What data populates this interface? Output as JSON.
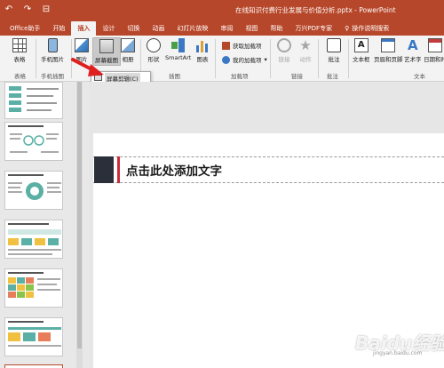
{
  "window": {
    "title": "在线知识付费行业发展与价值分析.pptx - PowerPoint",
    "quick_access": [
      "↶",
      "↷",
      "⊟"
    ]
  },
  "tabs": [
    {
      "label": "Office助手",
      "active": false
    },
    {
      "label": "开始",
      "active": false
    },
    {
      "label": "插入",
      "active": true
    },
    {
      "label": "设计",
      "active": false
    },
    {
      "label": "切换",
      "active": false
    },
    {
      "label": "动画",
      "active": false
    },
    {
      "label": "幻灯片放映",
      "active": false
    },
    {
      "label": "审阅",
      "active": false
    },
    {
      "label": "视图",
      "active": false
    },
    {
      "label": "帮助",
      "active": false
    },
    {
      "label": "万兴PDF专家",
      "active": false
    }
  ],
  "tell_me": "操作说明搜索",
  "ribbon": {
    "table": "表格",
    "phone_picture": "手机图片",
    "picture": "图片",
    "screenshot": "屏幕截图",
    "album": "相册",
    "shape": "形状",
    "smartart": "SmartArt",
    "chart": "图表",
    "get_addins": "获取加载项",
    "my_addins": "我的加载项",
    "link": "链接",
    "action": "动作",
    "comment": "批注",
    "textbox": "文本框",
    "header_footer": "页眉和页脚",
    "wordart": "艺术字",
    "date_time": "日期和时",
    "groups": {
      "table": "表格",
      "phone_plugin": "手机插图",
      "illustrations": "插图",
      "addins": "加载项",
      "links": "链接",
      "comments": "批注",
      "text": "文本"
    }
  },
  "dropdown": {
    "item": "屏幕剪辑(C)"
  },
  "slide": {
    "title_placeholder": "点击此处添加文字"
  },
  "watermark": {
    "brand": "Baidu经验",
    "sub": "jingyan.baidu.com"
  },
  "colors": {
    "brand": "#b7472a",
    "accent_red": "#cc2b3a",
    "arrow": "#e02020"
  }
}
